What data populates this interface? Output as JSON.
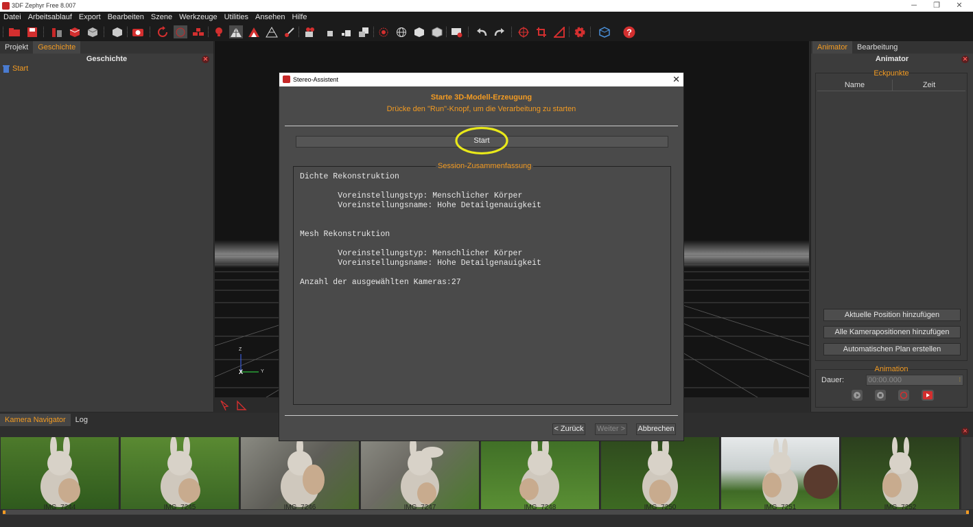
{
  "app": {
    "title": "3DF Zephyr Free 8.007"
  },
  "menu": [
    "Datei",
    "Arbeitsablauf",
    "Export",
    "Bearbeiten",
    "Szene",
    "Werkzeuge",
    "Utilities",
    "Ansehen",
    "Hilfe"
  ],
  "left_panel": {
    "tabs": [
      "Projekt",
      "Geschichte"
    ],
    "header": "Geschichte",
    "items": [
      "Start"
    ]
  },
  "right_panel": {
    "tabs": [
      "Animator",
      "Bearbeitung"
    ],
    "header": "Animator",
    "keyframes_group": "Eckpunkte",
    "columns": [
      "Name",
      "Zeit"
    ],
    "buttons": [
      "Aktuelle Position hinzufügen",
      "Alle Kamerapositionen hinzufügen",
      "Automatischen Plan erstellen"
    ],
    "animation_group": "Animation",
    "duration_label": "Dauer:",
    "duration_value": "00:00.000"
  },
  "bottom_panel": {
    "tabs": [
      "Kamera Navigator",
      "Log"
    ],
    "thumbnails": [
      "IMG_7244",
      "IMG_7245",
      "IMG_7246",
      "IMG_7247",
      "IMG_7248",
      "IMG_7250",
      "IMG_7251",
      "IMG_7252"
    ]
  },
  "viewport": {
    "axis_labels": {
      "z": "Z",
      "x": "X",
      "y": "Y"
    }
  },
  "dialog": {
    "title": "Stereo-Assistent",
    "heading": "Starte 3D-Modell-Erzeugung",
    "subheading": "Drücke den \"Run\"-Knopf, um die Verarbeitung zu starten",
    "start_button": "Start",
    "summary_title": "Session-Zusammenfassung",
    "summary_text": "Dichte Rekonstruktion\n\n        Voreinstellungstyp: Menschlicher Körper\n        Voreinstellungsname: Hohe Detailgenauigkeit\n\n\nMesh Rekonstruktion\n\n        Voreinstellungstyp: Menschlicher Körper\n        Voreinstellungsname: Hohe Detailgenauigkeit\n\nAnzahl der ausgewählten Kameras:27",
    "back_button": "< Zurück",
    "next_button": "Weiter >",
    "cancel_button": "Abbrechen"
  },
  "colors": {
    "accent": "#f39b22",
    "highlight_circle": "#e8e81a"
  }
}
